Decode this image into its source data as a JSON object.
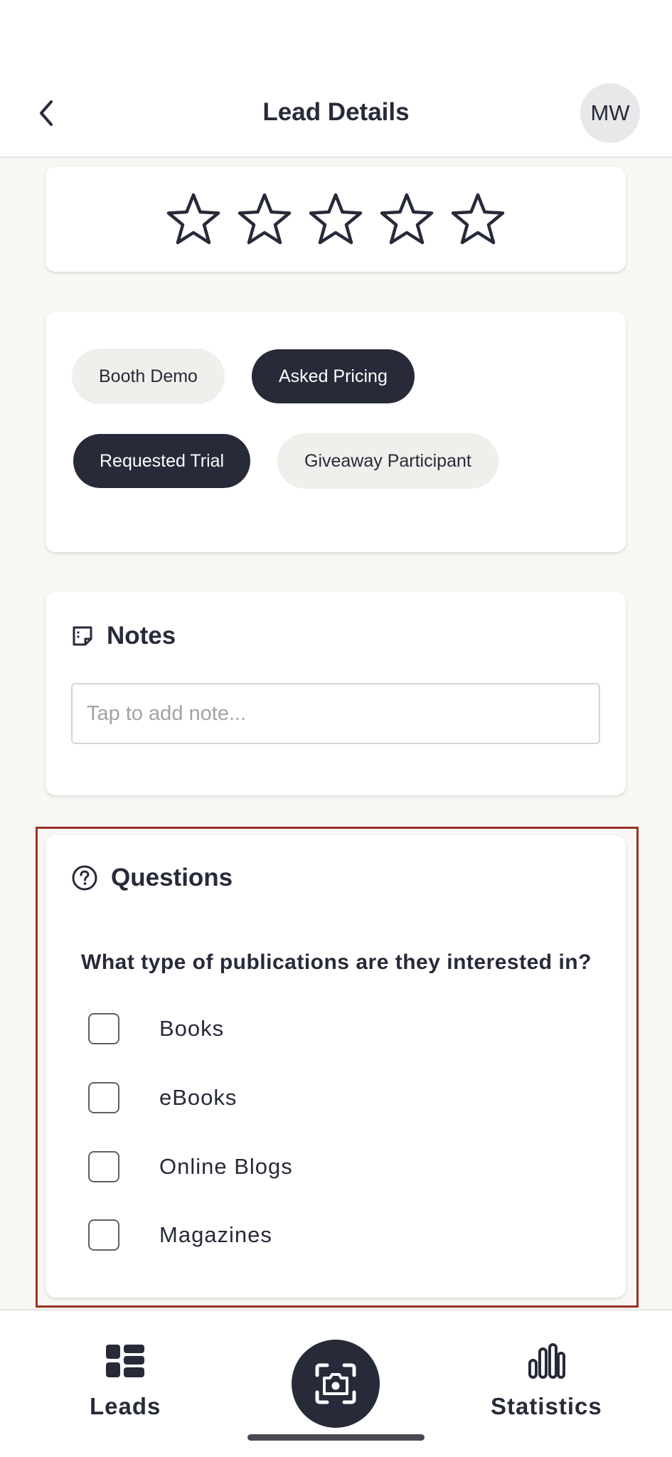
{
  "header": {
    "title": "Lead Details",
    "avatar_initials": "MW"
  },
  "rating": {
    "value": 0,
    "max": 5
  },
  "tags": {
    "items": [
      {
        "label": "Booth Demo",
        "selected": false
      },
      {
        "label": "Asked Pricing",
        "selected": true
      },
      {
        "label": "Requested Trial",
        "selected": true
      },
      {
        "label": "Giveaway Participant",
        "selected": false
      }
    ]
  },
  "notes": {
    "title": "Notes",
    "placeholder": "Tap to add note...",
    "value": ""
  },
  "questions": {
    "title": "Questions",
    "question": "What type of publications are they interested in?",
    "options": [
      {
        "label": "Books",
        "checked": false
      },
      {
        "label": "eBooks",
        "checked": false
      },
      {
        "label": "Online Blogs",
        "checked": false
      },
      {
        "label": "Magazines",
        "checked": false
      }
    ]
  },
  "bottom_nav": {
    "leads_label": "Leads",
    "statistics_label": "Statistics"
  },
  "colors": {
    "primary": "#272a38",
    "chip_light": "#f0efeb",
    "highlight": "#9a3322",
    "background": "#f8f7f4"
  }
}
